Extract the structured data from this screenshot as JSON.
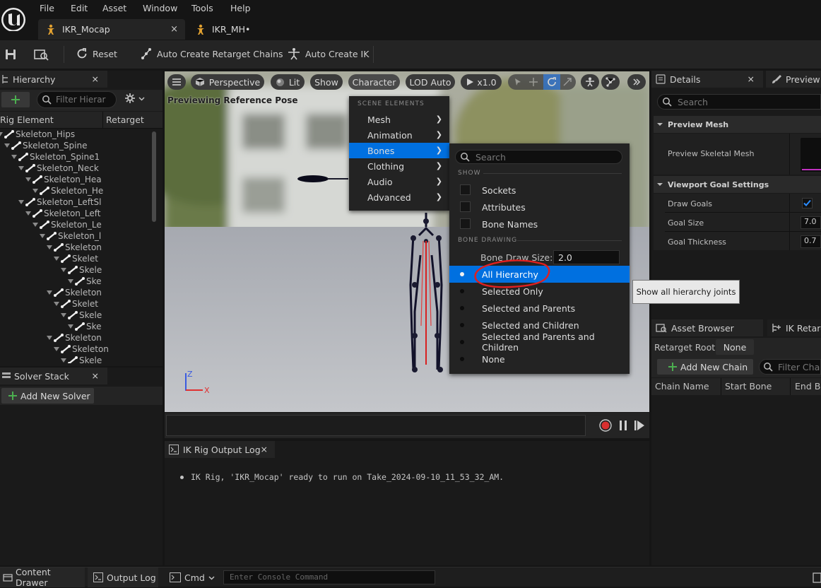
{
  "menu": [
    "File",
    "Edit",
    "Asset",
    "Window",
    "Tools",
    "Help"
  ],
  "tabs": [
    {
      "label": "IKR_Mocap",
      "close": "×"
    },
    {
      "label": "IKR_MH•"
    }
  ],
  "toolbar": {
    "reset": "Reset",
    "auto_chains": "Auto Create Retarget Chains",
    "auto_ik": "Auto Create IK"
  },
  "hierarchy": {
    "title": "Hierarchy",
    "close": "×",
    "filter_placeholder": "Filter Hierar",
    "columns": [
      "Rig Element",
      "Retarget C"
    ],
    "rows": [
      "Skeleton_Hips",
      "Skeleton_Spine",
      "Skeleton_Spine1",
      "Skeleton_Neck",
      "Skeleton_Hea",
      "Skeleton_He",
      "Skeleton_LeftSl",
      "Skeleton_Left",
      "Skeleton_Le",
      "Skeleton_l",
      "Skeleton",
      "Skelet",
      "Skele",
      "Ske",
      "Skeleton",
      "Skelet",
      "Skele",
      "Ske",
      "Skeleton",
      "Skeleton",
      "Skele"
    ]
  },
  "solver": {
    "title": "Solver Stack",
    "close": "×",
    "add": "Add New Solver"
  },
  "viewport": {
    "perspective": "Perspective",
    "lit": "Lit",
    "show": "Show",
    "character": "Character",
    "lod": "LOD Auto",
    "speed": "x1.0",
    "overlay": "Previewing Reference Pose",
    "axis_z": "Z",
    "axis_x": "X"
  },
  "character_menu": {
    "section": "SCENE ELEMENTS",
    "items": [
      "Mesh",
      "Animation",
      "Bones",
      "Clothing",
      "Audio",
      "Advanced"
    ]
  },
  "bones_menu": {
    "search_placeholder": "Search",
    "show_section": "SHOW",
    "show_items": [
      "Sockets",
      "Attributes",
      "Bone Names"
    ],
    "drawing_section": "BONE DRAWING",
    "draw_size_label": "Bone Draw Size:",
    "draw_size_value": "2.0",
    "draw_items": [
      "All Hierarchy",
      "Selected Only",
      "Selected and Parents",
      "Selected and Children",
      "Selected and Parents and Children",
      "None"
    ],
    "tooltip": "Show all hierarchy joints"
  },
  "details": {
    "title": "Details",
    "close": "×",
    "preview_tab": "Preview",
    "search_placeholder": "Search",
    "section1": "Preview Mesh",
    "preview_label": "Preview Skeletal Mesh",
    "section2": "Viewport Goal Settings",
    "draw_goals": "Draw Goals",
    "goal_size": "Goal Size",
    "goal_size_value": "7.0",
    "goal_thickness": "Goal Thickness",
    "goal_thickness_value": "0.7"
  },
  "asset_browser": {
    "title": "Asset Browser",
    "ik_tab": "IK Retarg",
    "root_label": "Retarget Root:",
    "root_value": "None",
    "add_chain": "Add New Chain",
    "filter_placeholder": "Filter Chain",
    "columns": [
      "Chain Name",
      "Start Bone",
      "End Bo"
    ]
  },
  "output_log": {
    "title": "IK Rig Output Log",
    "close": "×",
    "message": "IK Rig, 'IKR_Mocap' ready to run on Take_2024-09-10_11_53_32_AM."
  },
  "statusbar": {
    "content_drawer": "Content Drawer",
    "output_log": "Output Log",
    "cmd": "Cmd",
    "console_placeholder": "Enter Console Command"
  },
  "colors": {
    "selection": "#0070e0",
    "accent_green": "#4caf50",
    "annotation_red": "#e02020",
    "record_red": "#d83030"
  }
}
